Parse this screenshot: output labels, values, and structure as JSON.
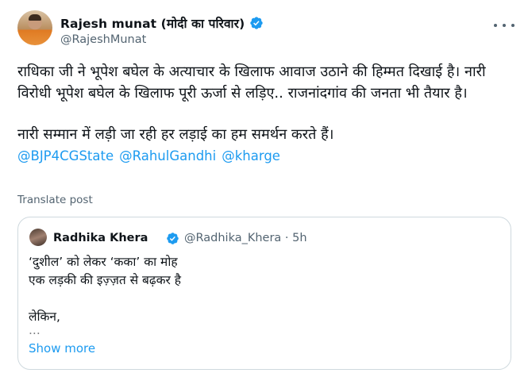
{
  "author": {
    "name": "Rajesh munat (मोदी का परिवार)",
    "handle": "@RajeshMunat"
  },
  "icons": {
    "verified": "verified-badge-icon",
    "more": "more-horizontal-icon",
    "verified_color": "#1d9bf0"
  },
  "tweet": {
    "line1": "राधिका जी ने भूपेश बघेल के अत्याचार के खिलाफ आवाज उठाने की हिम्मत दिखाई है। नारी विरोधी भूपेश बघेल के खिलाफ पूरी ऊर्जा से लड़िए.. राजनांदगांव की जनता भी तैयार है।",
    "line2": "नारी सम्मान में लड़ी जा रही हर लड़ाई का हम समर्थन करते हैं।",
    "mentions": [
      "@BJP4CGState",
      "@RahulGandhi",
      "@kharge"
    ]
  },
  "translate_label": "Translate post",
  "quote": {
    "name": "Radhika Khera",
    "handle": "@Radhika_Khera · 5h",
    "lines": [
      "‘दुशील’ को लेकर ‘कका’ का मोह",
      "एक लड़की की इज़्ज़त से बढ़कर है",
      "",
      "लेकिन,",
      "..."
    ],
    "show_more": "Show more"
  }
}
